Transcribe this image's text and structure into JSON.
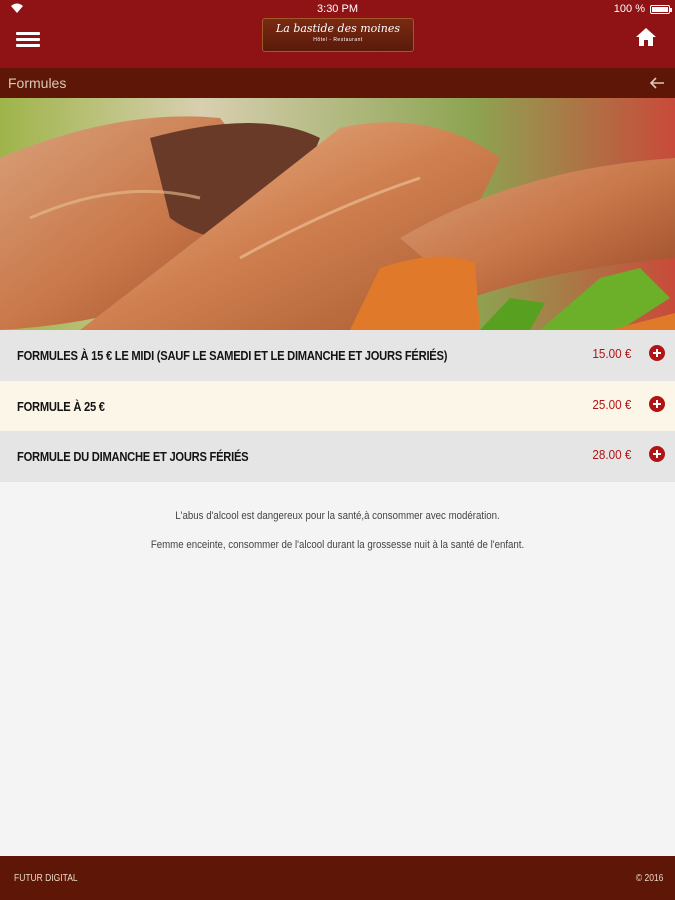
{
  "status_bar": {
    "time": "3:30 PM",
    "battery": "100 %"
  },
  "header": {
    "logo_name": "La bastide des moines",
    "logo_sub": "Hôtel - Restaurant"
  },
  "subbar": {
    "title": "Formules"
  },
  "formulas": [
    {
      "label": "FORMULES À 15 € LE MIDI (SAUF LE SAMEDI ET LE DIMANCHE ET JOURS FÉRIÉS)",
      "price": "15.00 €"
    },
    {
      "label": "FORMULE À 25 €",
      "price": "25.00 €"
    },
    {
      "label": "FORMULE DU DIMANCHE ET JOURS FÉRIÉS",
      "price": "28.00 €"
    }
  ],
  "notices": [
    "L'abus d'alcool est dangereux pour la santé,à consommer avec modération.",
    "Femme enceinte, consommer de l'alcool durant la grossesse nuit à la santé de l'enfant."
  ],
  "footer": {
    "left": "FUTUR DIGITAL",
    "right": "© 2016"
  },
  "colors": {
    "header": "#8f1214",
    "subbar": "#5e1607",
    "price": "#b01414",
    "row_gray": "#e5e5e5",
    "row_cream": "#fcf6e8"
  }
}
